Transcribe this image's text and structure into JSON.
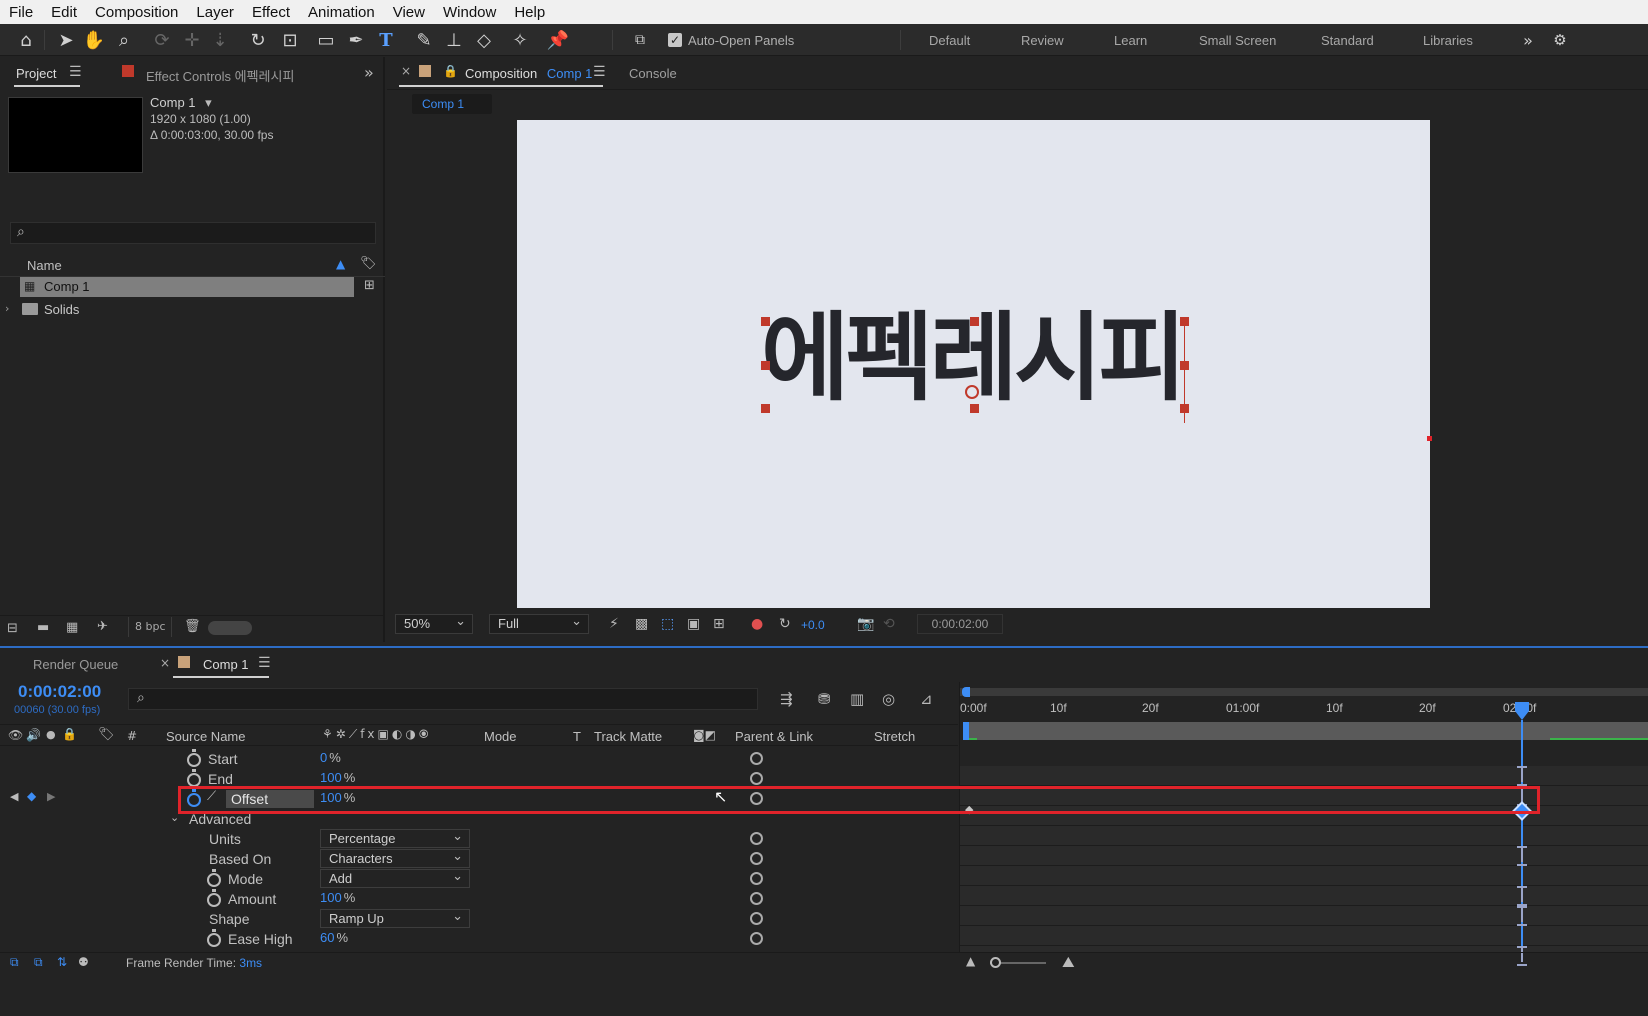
{
  "menu": [
    "File",
    "Edit",
    "Composition",
    "Layer",
    "Effect",
    "Animation",
    "View",
    "Window",
    "Help"
  ],
  "toolbar": {
    "auto_open_label": "Auto-Open Panels",
    "auto_open_checked": true,
    "workspaces": [
      "Default",
      "Review",
      "Learn",
      "Small Screen",
      "Standard",
      "Libraries"
    ]
  },
  "project": {
    "tab_project": "Project",
    "tab_effect_controls": "Effect Controls 에펙레시피",
    "comp_name": "Comp 1",
    "comp_size": "1920 x 1080 (1.00)",
    "comp_duration": "Δ 0:00:03:00, 30.00 fps",
    "name_header": "Name",
    "items": [
      {
        "label": "Comp 1",
        "icon": "composition-icon"
      },
      {
        "label": "Solids",
        "icon": "folder-icon"
      }
    ],
    "bpc": "8 bpc"
  },
  "composition": {
    "tab_label": "Composition",
    "tab_comp": "Comp 1",
    "console": "Console",
    "breadcrumb": "Comp 1",
    "text": "에펙레시피",
    "canvas_color": "#e3e6ee",
    "zoom": "50%",
    "resolution": "Full",
    "exposure": "+0.0",
    "timecode": "0:00:02:00"
  },
  "timeline": {
    "render_queue": "Render Queue",
    "tab_comp": "Comp 1",
    "current_time": "0:00:02:00",
    "frames": "00060 (30.00 fps)",
    "columns": {
      "hash": "#",
      "source_name": "Source Name",
      "mode": "Mode",
      "t": "T",
      "track_matte": "Track Matte",
      "parent": "Parent & Link",
      "stretch": "Stretch"
    },
    "ruler": [
      "0:00f",
      "10f",
      "20f",
      "01:00f",
      "10f",
      "20f",
      "02:00f"
    ],
    "properties": [
      {
        "name": "Start",
        "value": "0",
        "unit": "%",
        "stopwatch": true
      },
      {
        "name": "End",
        "value": "100",
        "unit": "%",
        "stopwatch": true
      },
      {
        "name": "Offset",
        "value": "100",
        "unit": "%",
        "stopwatch": true,
        "animated": true,
        "selected": true
      },
      {
        "name": "Advanced",
        "group": true
      },
      {
        "name": "Units",
        "dropdown": "Percentage"
      },
      {
        "name": "Based On",
        "dropdown": "Characters"
      },
      {
        "name": "Mode",
        "dropdown": "Add",
        "stopwatch": true
      },
      {
        "name": "Amount",
        "value": "100",
        "unit": "%",
        "stopwatch": true
      },
      {
        "name": "Shape",
        "dropdown": "Ramp Up"
      },
      {
        "name": "Ease High",
        "value": "60",
        "unit": "%",
        "stopwatch": true
      }
    ],
    "status_label": "Frame Render Time:",
    "status_value": "3ms"
  },
  "colors": {
    "accent": "#3d8df5",
    "highlight": "#e0232a",
    "handle": "#c0392b"
  }
}
